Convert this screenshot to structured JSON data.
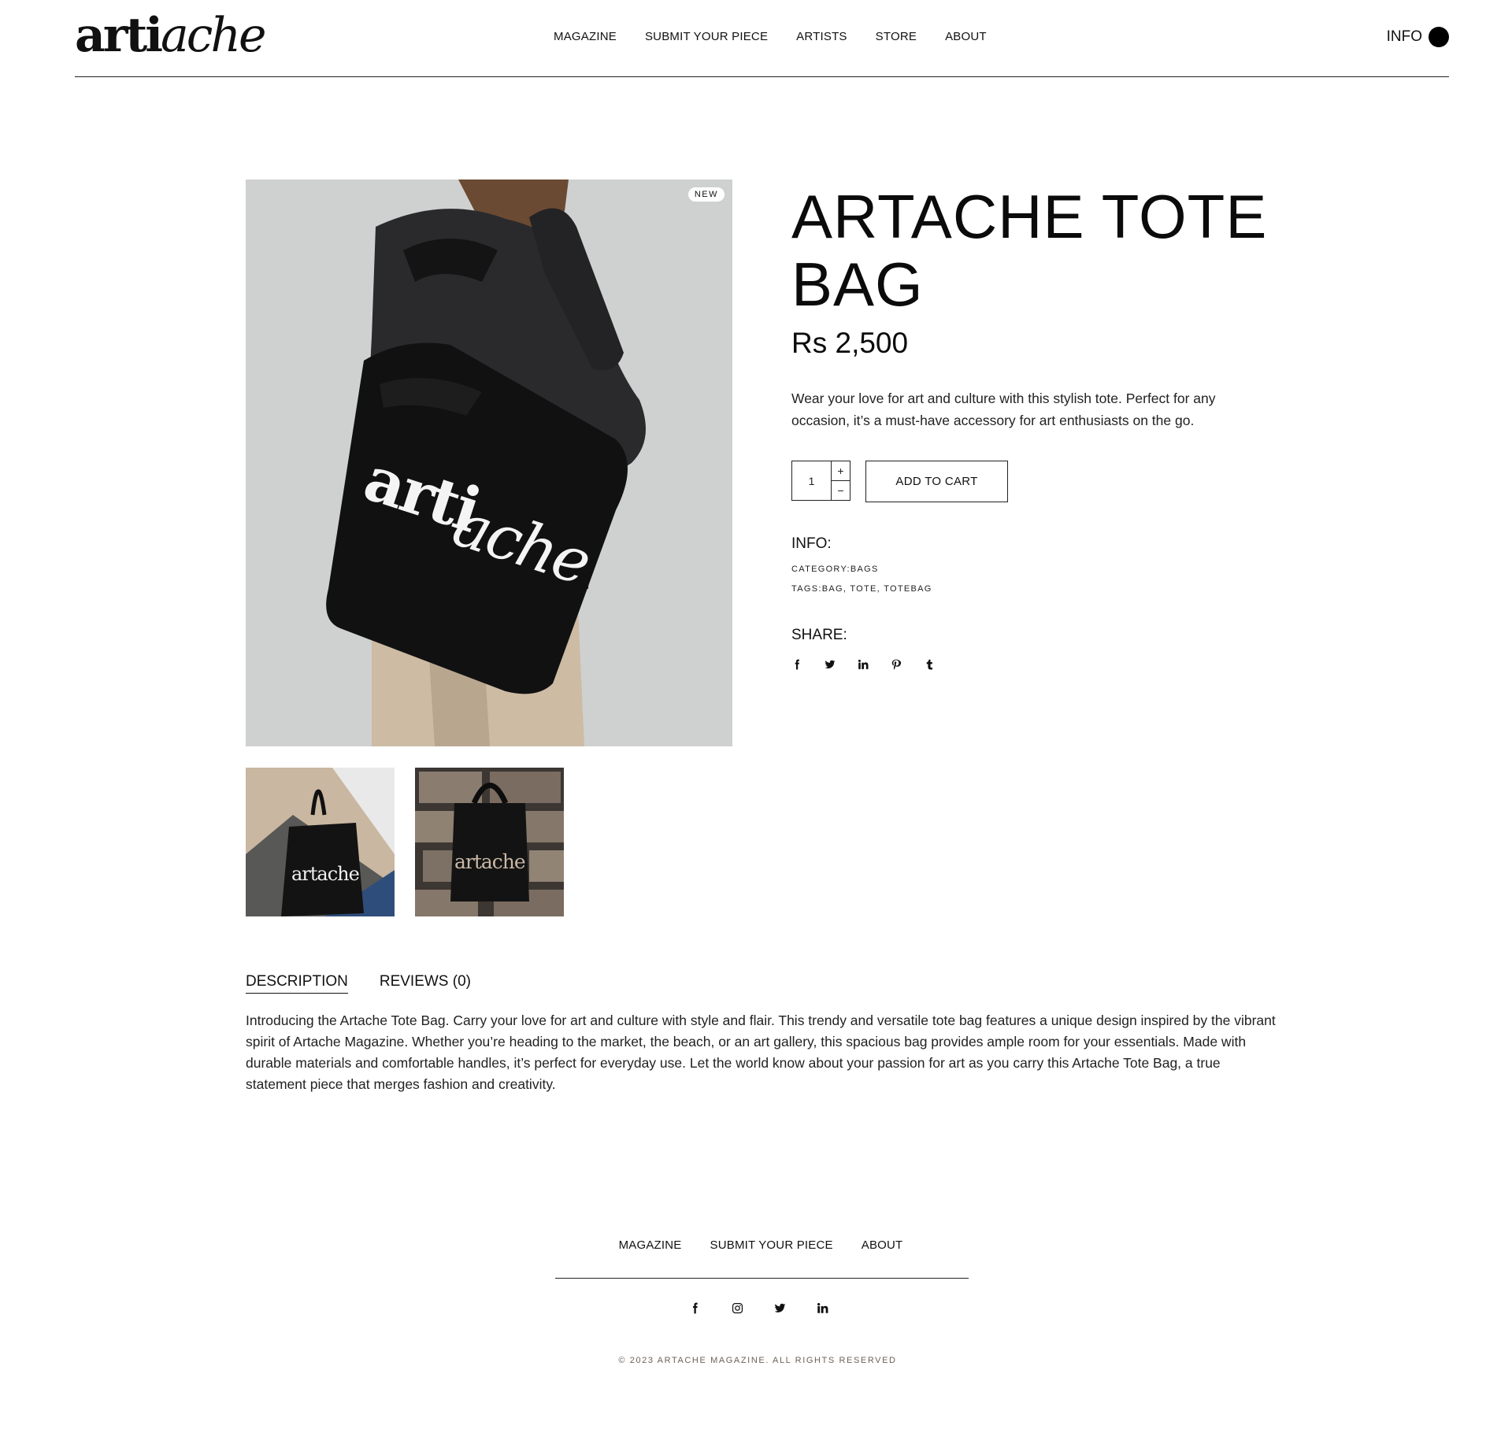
{
  "brand": {
    "logo_text": "artache",
    "logo_bold": "arti",
    "logo_light": "ache"
  },
  "nav": {
    "items": [
      {
        "label": "MAGAZINE"
      },
      {
        "label": "SUBMIT YOUR PIECE"
      },
      {
        "label": "ARTISTS"
      },
      {
        "label": "STORE"
      },
      {
        "label": "ABOUT"
      }
    ],
    "info_label": "INFO"
  },
  "product": {
    "badge": "NEW",
    "title": "ARTACHE TOTE BAG",
    "price": "Rs 2,500",
    "short_description": "Wear your love for art and culture with this stylish tote. Perfect for any occasion, it’s a must-have accessory for art enthusiasts on the go.",
    "quantity": "1",
    "qty_plus": "+",
    "qty_minus": "−",
    "add_to_cart_label": "ADD TO CART",
    "info_heading": "INFO:",
    "category_label": "CATEGORY:",
    "category_value": "BAGS",
    "tags_label": "TAGS:",
    "tags_value": "BAG, TOTE, TOTEBAG",
    "share_heading": "SHARE:",
    "share_icons": [
      "facebook-icon",
      "twitter-icon",
      "linkedin-icon",
      "pinterest-icon",
      "tumblr-icon"
    ]
  },
  "tabs": [
    {
      "label": "DESCRIPTION",
      "active": true
    },
    {
      "label": "REVIEWS (0)",
      "active": false
    }
  ],
  "description": "Introducing the Artache Tote Bag. Carry your love for art and culture with style and flair. This trendy and versatile tote bag features a unique design inspired by the vibrant spirit of Artache Magazine. Whether you’re heading to the market, the beach, or an art gallery, this spacious bag provides ample room for your essentials. Made with durable materials and comfortable handles, it’s perfect for everyday use. Let the world know about your passion for art as you carry this Artache Tote Bag, a true statement piece that merges fashion and creativity.",
  "footer": {
    "nav": [
      {
        "label": "MAGAZINE"
      },
      {
        "label": "SUBMIT YOUR PIECE"
      },
      {
        "label": "ABOUT"
      }
    ],
    "social_icons": [
      "facebook-icon",
      "instagram-icon",
      "twitter-icon",
      "linkedin-icon"
    ],
    "copyright": "© 2023 ARTACHE MAGAZINE. ALL RIGHTS RESERVED"
  },
  "colors": {
    "text": "#111111",
    "background": "#ffffff",
    "image_bg": "#cfd1d0",
    "copyright": "#6d6157"
  }
}
